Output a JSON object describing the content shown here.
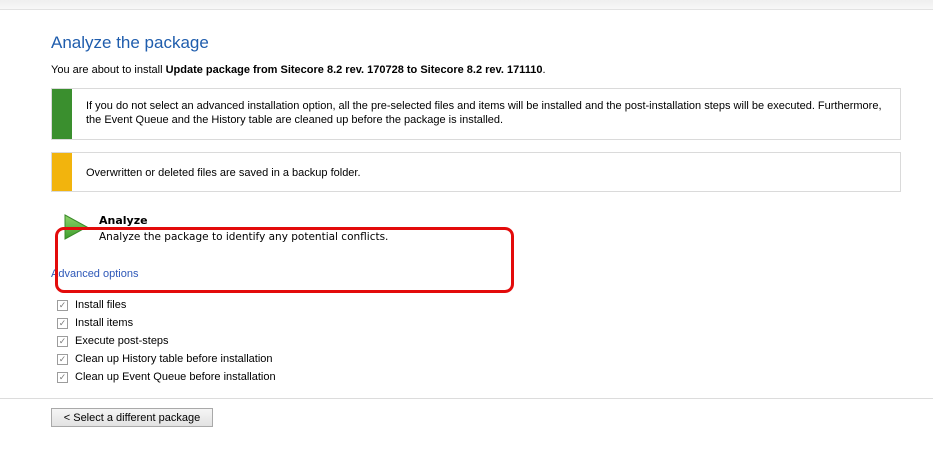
{
  "page": {
    "title": "Analyze the package",
    "intro_prefix": "You are about to install ",
    "intro_package": "Update package from Sitecore 8.2 rev. 170728 to Sitecore 8.2 rev. 171110",
    "intro_suffix": "."
  },
  "notices": {
    "info": "If you do not select an advanced installation option, all the pre-selected files and items will be installed and the post-installation steps will be executed. Furthermore, the Event Queue and the History table are cleaned up before the package is installed.",
    "info_color": "#3a8f2e",
    "warning": "Overwritten or deleted files are saved in a backup folder.",
    "warning_color": "#f2b40d"
  },
  "analyze": {
    "icon": "play-arrow-icon",
    "title": "Analyze",
    "description": "Analyze the package to identify any potential conflicts."
  },
  "advanced": {
    "link_label": "Advanced options",
    "options": [
      {
        "label": "Install files",
        "checked": true
      },
      {
        "label": "Install items",
        "checked": true
      },
      {
        "label": "Execute post-steps",
        "checked": true
      },
      {
        "label": "Clean up History table before installation",
        "checked": true
      },
      {
        "label": "Clean up Event Queue before installation",
        "checked": true
      }
    ]
  },
  "footer": {
    "back_button": "< Select a different package"
  },
  "colors": {
    "title": "#1f5dad",
    "link": "#2e58b8",
    "highlight": "#e30b0b"
  }
}
